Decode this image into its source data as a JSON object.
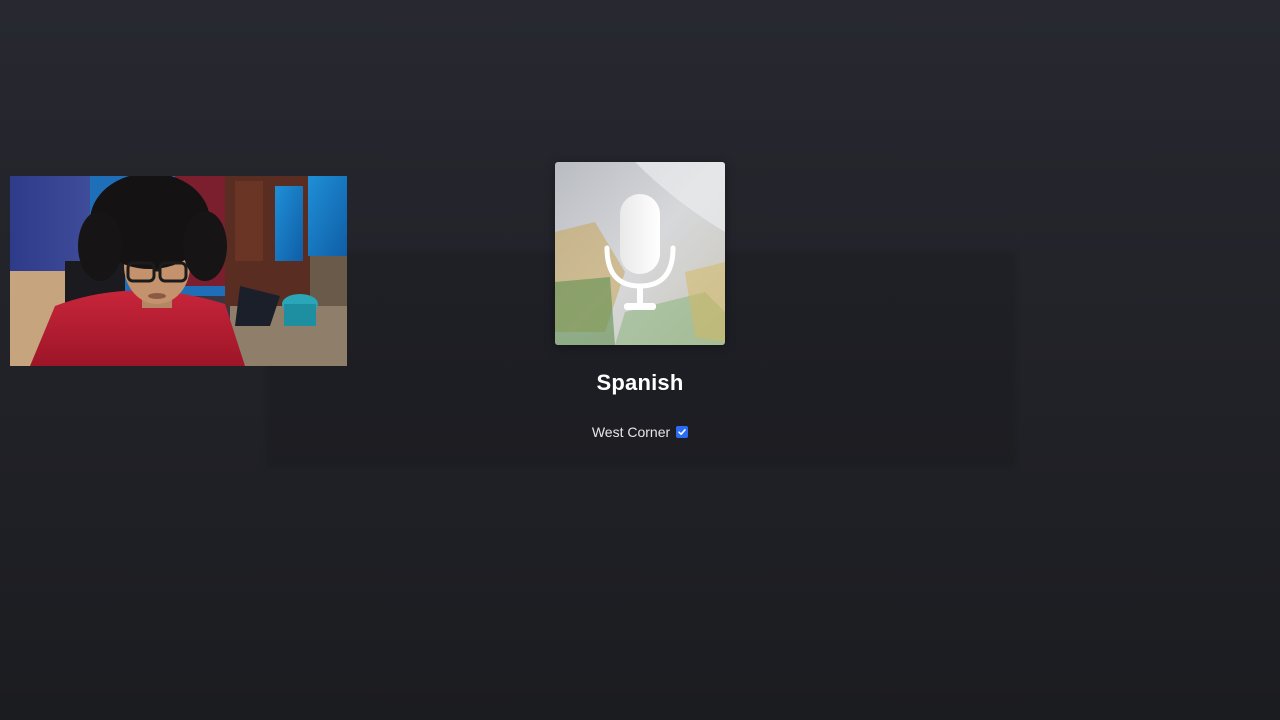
{
  "player": {
    "track_title": "Spanish",
    "artist_name": "West Corner",
    "artist_verified": true,
    "cover_icon": "microphone-icon",
    "verified_icon": "verified-checkmark-icon"
  },
  "webcam": {
    "present": true
  },
  "colors": {
    "background_top": "#272830",
    "background_bottom": "#1b1c20",
    "title": "#ffffff",
    "artist": "#e6e7ea",
    "verified_badge": "#2a6cf5"
  }
}
